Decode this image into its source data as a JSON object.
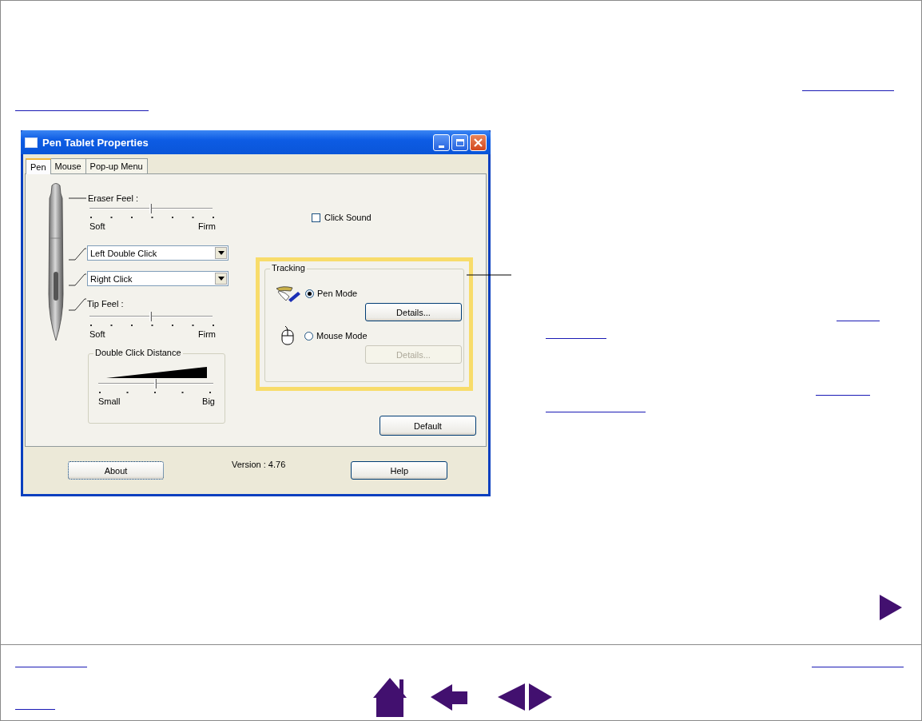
{
  "window": {
    "title": "Pen Tablet Properties"
  },
  "tabs": [
    {
      "label": "Pen",
      "selected": true
    },
    {
      "label": "Mouse",
      "selected": false
    },
    {
      "label": "Pop-up Menu",
      "selected": false
    }
  ],
  "eraser_feel": {
    "label": "Eraser Feel :",
    "level": 0.5,
    "min_label": "Soft",
    "max_label": "Firm"
  },
  "button_dropdowns": [
    {
      "value": "Left Double Click"
    },
    {
      "value": "Right Click"
    }
  ],
  "tip_feel": {
    "label": "Tip Feel :",
    "level": 0.5,
    "min_label": "Soft",
    "max_label": "Firm"
  },
  "double_click_distance": {
    "label": "Double Click Distance",
    "level": 0.5,
    "min_label": "Small",
    "max_label": "Big"
  },
  "click_sound": {
    "label": "Click Sound",
    "checked": false
  },
  "tracking": {
    "label": "Tracking",
    "modes": [
      {
        "kind": "pen",
        "label": "Pen Mode",
        "selected": true,
        "details": "Details...",
        "disabled": false
      },
      {
        "kind": "mouse",
        "label": "Mouse Mode",
        "selected": false,
        "details": "Details...",
        "disabled": true
      }
    ]
  },
  "default_button": "Default",
  "about_button": "About",
  "version": "Version : 4.76",
  "help_button": "Help"
}
